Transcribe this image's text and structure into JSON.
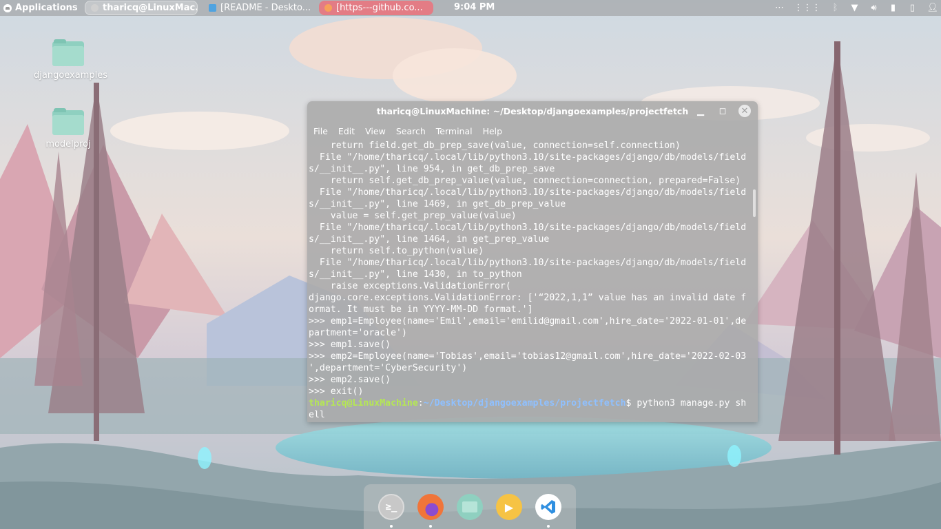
{
  "panel": {
    "apps_label": "Applications",
    "tasks": [
      {
        "label": "tharicq@LinuxMac...",
        "state": "active"
      },
      {
        "label": "[README - Deskto...",
        "state": "normal"
      },
      {
        "label": "[https---github.co...",
        "state": "highlighted"
      }
    ],
    "clock": "9:04 PM",
    "tray_icons": [
      "more-icon",
      "grid-icon",
      "bluetooth-icon",
      "wifi-icon",
      "volume-icon",
      "battery-icon",
      "clipboard-icon",
      "user-icon"
    ]
  },
  "desktop": {
    "icons": [
      {
        "label": "djangoexamples",
        "icon": "folder-icon"
      },
      {
        "label": "modelproj",
        "icon": "folder-icon"
      }
    ]
  },
  "terminal": {
    "title": "tharicq@LinuxMachine: ~/Desktop/djangoexamples/projectfetch",
    "menu": [
      "File",
      "Edit",
      "View",
      "Search",
      "Terminal",
      "Help"
    ],
    "lines": [
      "    return field.get_db_prep_save(value, connection=self.connection)",
      "  File \"/home/tharicq/.local/lib/python3.10/site-packages/django/db/models/field",
      "s/__init__.py\", line 954, in get_db_prep_save",
      "    return self.get_db_prep_value(value, connection=connection, prepared=False)",
      "  File \"/home/tharicq/.local/lib/python3.10/site-packages/django/db/models/field",
      "s/__init__.py\", line 1469, in get_db_prep_value",
      "    value = self.get_prep_value(value)",
      "  File \"/home/tharicq/.local/lib/python3.10/site-packages/django/db/models/field",
      "s/__init__.py\", line 1464, in get_prep_value",
      "    return self.to_python(value)",
      "  File \"/home/tharicq/.local/lib/python3.10/site-packages/django/db/models/field",
      "s/__init__.py\", line 1430, in to_python",
      "    raise exceptions.ValidationError(",
      "django.core.exceptions.ValidationError: ['“2022,1,1” value has an invalid date f",
      "ormat. It must be in YYYY-MM-DD format.']",
      ">>> emp1=Employee(name='Emil',email='emilid@gmail.com',hire_date='2022-01-01',de",
      "partment='oracle')",
      ">>> emp1.save()",
      ">>> emp2=Employee(name='Tobias',email='tobias12@gmail.com',hire_date='2022-02-03",
      "',department='CyberSecurity')",
      ">>> emp2.save()",
      ">>> exit()"
    ],
    "prompt": {
      "user_host": "tharicq@LinuxMachine",
      "sep": ":",
      "path": "~/Desktop/djangoexamples/projectfetch",
      "dollar": "$ ",
      "command": "python3 manage.py sh",
      "command_wrap": "ell"
    }
  },
  "dock": {
    "items": [
      {
        "name": "terminal-icon",
        "color": "#bfbfbf",
        "glyph": "≥_"
      },
      {
        "name": "firefox-icon",
        "color": "#f47b3c",
        "glyph": ""
      },
      {
        "name": "files-icon",
        "color": "#8fd0c0",
        "glyph": ""
      },
      {
        "name": "media-player-icon",
        "color": "#f6c344",
        "glyph": "▶"
      },
      {
        "name": "vscode-icon",
        "color": "#ffffff",
        "glyph": ""
      }
    ]
  }
}
